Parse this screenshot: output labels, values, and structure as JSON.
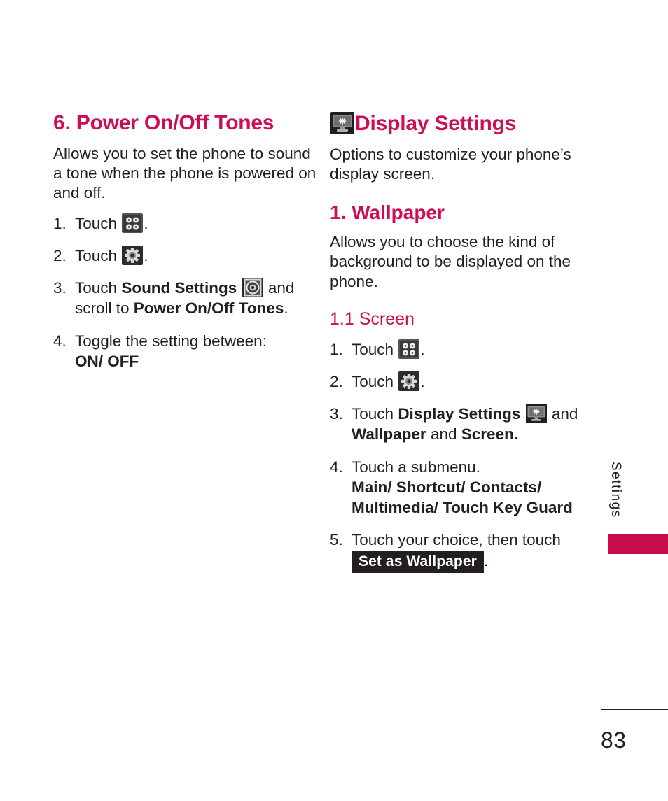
{
  "page": {
    "number": "83",
    "side_tab_label": "Settings",
    "accent_color": "#ce0e53",
    "tab_color": "#c80b4b",
    "text_color": "#231f20"
  },
  "left_column": {
    "heading": "6. Power On/Off Tones",
    "intro": "Allows you to set the phone to sound a tone when the phone is powered on and off.",
    "steps": [
      {
        "num": "1.",
        "text_before": "Touch",
        "icon": "menu-grid-icon",
        "text_after": "."
      },
      {
        "num": "2.",
        "text_before": "Touch",
        "icon": "gear-icon",
        "text_after": "."
      },
      {
        "num": "3.",
        "text_before": "Touch",
        "bold_1": "Sound Settings",
        "icon": "speaker-icon",
        "text_mid": "and scroll to",
        "bold_2": "Power On/Off Tones",
        "text_after": "."
      },
      {
        "num": "4.",
        "text_before": "Toggle the setting between:",
        "bold_block": "ON/ OFF"
      }
    ]
  },
  "right_column": {
    "heading": "Display Settings",
    "heading_icon": "display-monitor-icon",
    "intro": "Options to customize your phone’s display screen.",
    "sub_heading": "1. Wallpaper",
    "sub_intro": "Allows you to choose the kind of background to be displayed on the phone.",
    "sub_sub_heading": "1.1 Screen",
    "steps": [
      {
        "num": "1.",
        "text_before": "Touch",
        "icon": "menu-grid-icon",
        "text_after": "."
      },
      {
        "num": "2.",
        "text_before": "Touch",
        "icon": "gear-icon",
        "text_after": "."
      },
      {
        "num": "3.",
        "text_before": "Touch",
        "bold_1": "Display Settings",
        "icon": "display-monitor-icon",
        "text_mid": "and",
        "bold_2": "Wallpaper",
        "text_mid_2": "and",
        "bold_3": "Screen."
      },
      {
        "num": "4.",
        "text_before": "Touch a submenu.",
        "bold_block": "Main/ Shortcut/ Contacts/ Multimedia/ Touch Key Guard"
      },
      {
        "num": "5.",
        "text_before": "Touch your choice, then touch",
        "badge": "Set as Wallpaper",
        "text_after": "."
      }
    ]
  }
}
